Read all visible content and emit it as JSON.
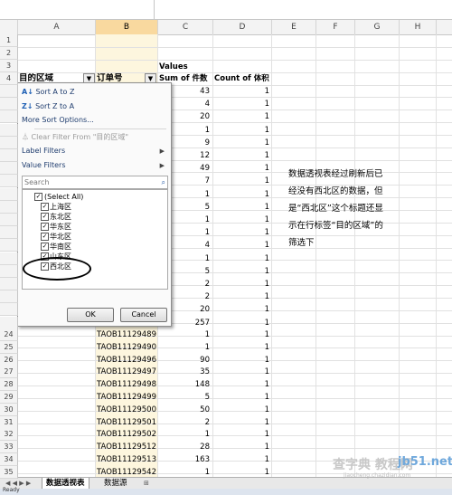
{
  "columns": [
    "A",
    "B",
    "C",
    "D",
    "E",
    "F",
    "G",
    "H"
  ],
  "row_numbers_top": [
    "1",
    "2",
    "3",
    "4"
  ],
  "row_numbers_bottom": [
    "24",
    "25",
    "26",
    "27",
    "28",
    "29",
    "30",
    "31",
    "32",
    "33",
    "34",
    "35"
  ],
  "pivot": {
    "values_label": "Values",
    "header_region": "目的区域",
    "header_order": "订单号",
    "header_sum": "Sum of 件数",
    "header_count": "Count of 体积",
    "visible_sum_values": [
      "43",
      "4",
      "20",
      "1",
      "9",
      "12",
      "49",
      "7",
      "1",
      "5",
      "1",
      "1",
      "4",
      "1",
      "5",
      "2",
      "2",
      "20",
      "257"
    ],
    "visible_count_values": [
      "1",
      "1",
      "1",
      "1",
      "1",
      "1",
      "1",
      "1",
      "1",
      "1",
      "1",
      "1",
      "1",
      "1",
      "1",
      "1",
      "1",
      "1",
      "1"
    ],
    "rows": [
      {
        "order": "TAOB11129489",
        "sum": "1",
        "count": "1"
      },
      {
        "order": "TAOB11129490",
        "sum": "1",
        "count": "1"
      },
      {
        "order": "TAOB11129496",
        "sum": "90",
        "count": "1"
      },
      {
        "order": "TAOB11129497",
        "sum": "35",
        "count": "1"
      },
      {
        "order": "TAOB11129498",
        "sum": "148",
        "count": "1"
      },
      {
        "order": "TAOB11129499",
        "sum": "5",
        "count": "1"
      },
      {
        "order": "TAOB11129500",
        "sum": "50",
        "count": "1"
      },
      {
        "order": "TAOB11129501",
        "sum": "2",
        "count": "1"
      },
      {
        "order": "TAOB11129502",
        "sum": "1",
        "count": "1"
      },
      {
        "order": "TAOB11129512",
        "sum": "28",
        "count": "1"
      },
      {
        "order": "TAOB11129513",
        "sum": "163",
        "count": "1"
      },
      {
        "order": "TAOB11129542",
        "sum": "1",
        "count": "1"
      }
    ]
  },
  "dropdown": {
    "sort_az": "Sort A to Z",
    "sort_za": "Sort Z to A",
    "more_sort": "More Sort Options...",
    "clear_filter": "Clear Filter From \"目的区域\"",
    "label_filters": "Label Filters",
    "value_filters": "Value Filters",
    "search_placeholder": "Search",
    "items": [
      "(Select All)",
      "上海区",
      "东北区",
      "华东区",
      "华北区",
      "华南区",
      "山东区",
      "西北区"
    ],
    "ok": "OK",
    "cancel": "Cancel"
  },
  "annotation": "数据透视表经过刷新后已经没有西北区的数据，但是“西北区”这个标题还显示在行标签“目的区域”的筛选下",
  "sheet_tabs": [
    "数据透视表",
    "数据源"
  ],
  "status": "Ready",
  "watermark": {
    "left": "查字典 教程网",
    "right": "jb51.net",
    "url": "jiaocheng.chazidian.com"
  },
  "colors": {
    "column_B_fill": "#fdf6de",
    "selected_col_header": "#f9d99f",
    "header_bg": "#f3f3f3"
  }
}
